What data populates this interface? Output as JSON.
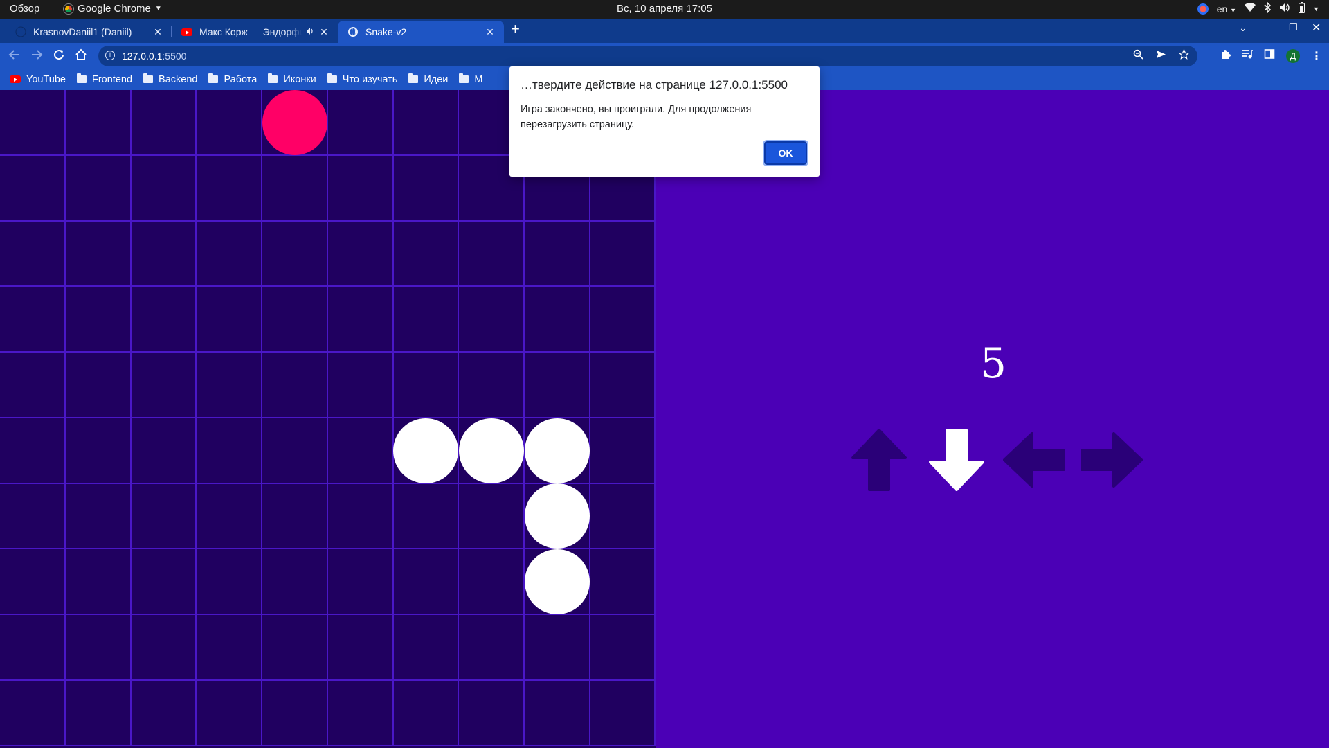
{
  "system_bar": {
    "overview": "Обзор",
    "app_name": "Google Chrome",
    "clock": "Вс, 10 апреля  17:05",
    "language": "en"
  },
  "browser": {
    "tabs": [
      {
        "title": "KrasnovDaniil1 (Daniil)",
        "icon": "github-icon"
      },
      {
        "title": "Макс Корж — Эндорфин",
        "icon": "youtube-icon",
        "audio": true
      },
      {
        "title": "Snake-v2",
        "icon": "globe-icon",
        "active": true
      }
    ],
    "url_host": "127.0.0.1",
    "url_port": ":5500",
    "profile_initial": "Д",
    "bookmarks": [
      {
        "label": "YouTube",
        "icon": "youtube-icon"
      },
      {
        "label": "Frontend",
        "icon": "folder-icon"
      },
      {
        "label": "Backend",
        "icon": "folder-icon"
      },
      {
        "label": "Работа",
        "icon": "folder-icon"
      },
      {
        "label": "Иконки",
        "icon": "folder-icon"
      },
      {
        "label": "Что изучать",
        "icon": "folder-icon"
      },
      {
        "label": "Идеи",
        "icon": "folder-icon"
      },
      {
        "label": "М",
        "icon": "folder-icon"
      }
    ]
  },
  "game": {
    "grid": {
      "columns": 10,
      "rows": 10
    },
    "food": {
      "col": 4,
      "row": 0
    },
    "snake": [
      {
        "col": 6,
        "row": 5
      },
      {
        "col": 7,
        "row": 5
      },
      {
        "col": 8,
        "row": 5
      },
      {
        "col": 8,
        "row": 6
      },
      {
        "col": 8,
        "row": 7
      }
    ],
    "score": "5",
    "direction_keys": [
      {
        "name": "up-arrow-icon",
        "active": false
      },
      {
        "name": "down-arrow-icon",
        "active": true
      },
      {
        "name": "left-arrow-icon",
        "active": false
      },
      {
        "name": "right-arrow-icon",
        "active": false
      }
    ],
    "colors": {
      "board": "#200060",
      "grid_lines": "#4a17c7",
      "panel": "#4b00b6",
      "snake": "#ffffff",
      "food": "#ff0066",
      "arrow_inactive": "#2a0078",
      "arrow_active": "#ffffff"
    }
  },
  "dialog": {
    "title": "…твердите действие на странице 127.0.0.1:5500",
    "message": "Игра закончено, вы проиграли. Для продолжения перезагрузить страницу.",
    "ok_label": "OK"
  }
}
